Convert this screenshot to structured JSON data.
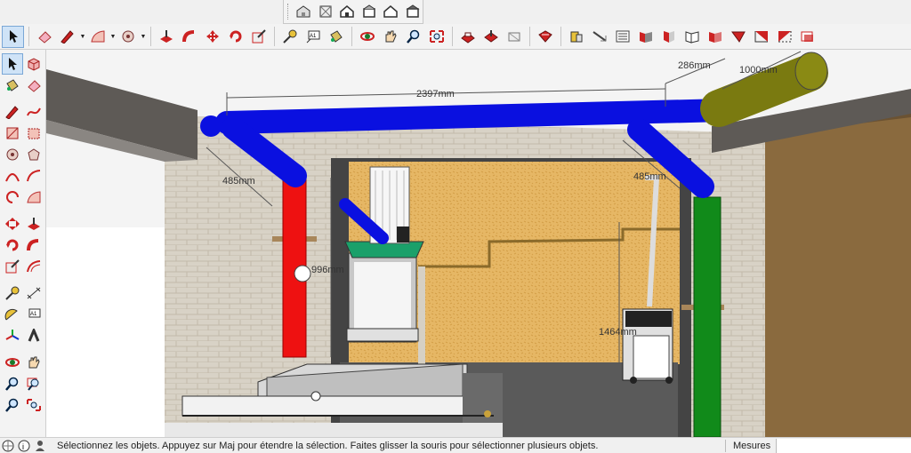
{
  "views_toolbar": {
    "items": [
      {
        "name": "iso-view-icon"
      },
      {
        "name": "top-view-icon"
      },
      {
        "name": "front-view-icon"
      },
      {
        "name": "right-view-icon"
      },
      {
        "name": "back-view-icon"
      },
      {
        "name": "left-view-icon"
      }
    ]
  },
  "viewport": {
    "dimensions": {
      "top_span": "2397mm",
      "right_short": "286mm",
      "right_long": "1000mm",
      "left_drop": "485mm",
      "right_drop": "485mm",
      "red_pipe": "996mm",
      "vacuum_height": "1464mm"
    }
  },
  "statusbar": {
    "message": "Sélectionnez les objets. Appuyez sur Maj pour étendre la sélection. Faites glisser la souris pour sélectionner plusieurs objets.",
    "measures_label": "Mesures",
    "measures_value": ""
  },
  "colors": {
    "blue_pipe": "#0a10e0",
    "red_pipe": "#ee1111",
    "green_pipe": "#118a1a",
    "olive_pipe": "#7a7a10",
    "osb": "#e6b765",
    "brick": "#d8d2c6",
    "beam": "#5e5a56"
  }
}
